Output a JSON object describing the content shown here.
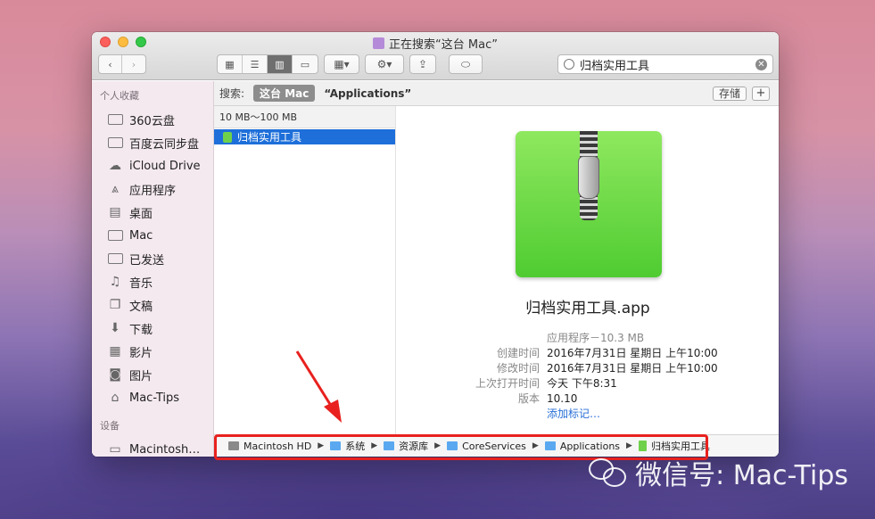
{
  "window": {
    "title": "正在搜索“这台 Mac”"
  },
  "search": {
    "value": "归档实用工具"
  },
  "sidebar": {
    "favorites_header": "个人收藏",
    "items": [
      {
        "label": "360云盘",
        "icon": "folder-icon"
      },
      {
        "label": "百度云同步盘",
        "icon": "folder-icon"
      },
      {
        "label": "iCloud Drive",
        "icon": "cloud-icon"
      },
      {
        "label": "应用程序",
        "icon": "applications-icon"
      },
      {
        "label": "桌面",
        "icon": "desktop-icon"
      },
      {
        "label": "Mac",
        "icon": "folder-icon"
      },
      {
        "label": "已发送",
        "icon": "folder-icon"
      },
      {
        "label": "音乐",
        "icon": "music-icon"
      },
      {
        "label": "文稿",
        "icon": "documents-icon"
      },
      {
        "label": "下载",
        "icon": "download-icon"
      },
      {
        "label": "影片",
        "icon": "movies-icon"
      },
      {
        "label": "图片",
        "icon": "pictures-icon"
      },
      {
        "label": "Mac-Tips",
        "icon": "home-icon"
      }
    ],
    "devices_header": "设备",
    "devices": [
      {
        "label": "Macintosh…",
        "icon": "disk-icon"
      }
    ]
  },
  "searchbar": {
    "label": "搜索:",
    "scope_active": "这台 Mac",
    "scope_other": "“Applications”",
    "save_label": "存储",
    "add_label": "+"
  },
  "list": {
    "group_header": "10 MB～100 MB",
    "selected_file": "归档实用工具"
  },
  "preview": {
    "app_name": "归档实用工具.app",
    "kind_size": "应用程序－10.3 MB",
    "rows": [
      {
        "key": "创建时间",
        "value": "2016年7月31日 星期日 上午10:00"
      },
      {
        "key": "修改时间",
        "value": "2016年7月31日 星期日 上午10:00"
      },
      {
        "key": "上次打开时间",
        "value": "今天 下午8:31"
      },
      {
        "key": "版本",
        "value": "10.10"
      }
    ],
    "add_tags": "添加标记…"
  },
  "pathbar": {
    "items": [
      {
        "label": "Macintosh HD",
        "color": "#8a8a8a"
      },
      {
        "label": "系统",
        "color": "#5aa9f0"
      },
      {
        "label": "资源库",
        "color": "#5aa9f0"
      },
      {
        "label": "CoreServices",
        "color": "#5aa9f0"
      },
      {
        "label": "Applications",
        "color": "#5aa9f0"
      },
      {
        "label": "归档实用工具",
        "color": "#6fd14a"
      }
    ]
  },
  "watermark": {
    "text": "微信号: Mac-Tips"
  },
  "colors": {
    "accent": "#1e6fd9",
    "highlight": "#e8211f"
  }
}
